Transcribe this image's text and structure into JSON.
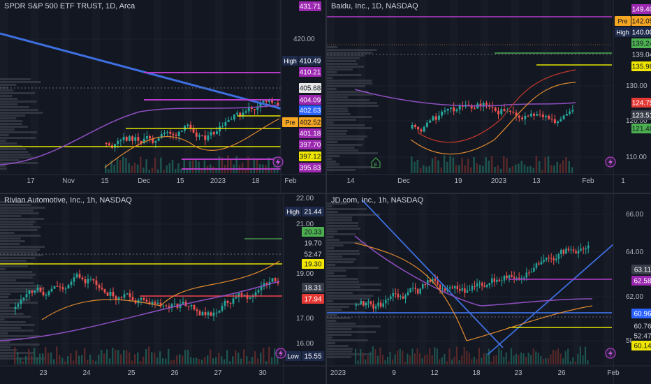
{
  "colors": {
    "background": "#131722",
    "grid": "#1e222d",
    "axis_text": "#b2b5be",
    "up": "#26a69a",
    "down": "#ef5350",
    "trendline": "#3d6fe0",
    "level_yellow": "#e6e600",
    "level_purple": "#b63cc8",
    "level_red": "#f04450",
    "level_green": "#4caf50",
    "ma_orange": "#e08a2e",
    "ma_purple": "#8e4fc0",
    "ma_red": "#c0392b"
  },
  "charts": [
    {
      "title": "SPDR S&P 500 ETF TRUST, 1D, Arca",
      "y_ticks": [
        "420.00"
      ],
      "x_ticks": [
        "17",
        "Nov",
        "15",
        "Dec",
        "15",
        "2023",
        "18",
        "Feb"
      ],
      "price_labels": [
        {
          "text": "431.71",
          "kind": "purple"
        },
        {
          "prefix": "High",
          "text": "410.49",
          "kind": "navy"
        },
        {
          "text": "410.21",
          "kind": "purple"
        },
        {
          "text": "405.68",
          "kind": "white"
        },
        {
          "text": "404.09",
          "kind": "purple"
        },
        {
          "text": "402.63",
          "kind": "blue"
        },
        {
          "prefix": "Pre",
          "text": "402.52",
          "kind": "orange"
        },
        {
          "text": "401.18",
          "kind": "purple"
        },
        {
          "text": "397.70",
          "kind": "purple"
        },
        {
          "text": "397.12",
          "kind": "yellow"
        },
        {
          "text": "395.83",
          "kind": "purple"
        }
      ],
      "icons": [
        "lightning-icon"
      ]
    },
    {
      "title": "Baidu, Inc., 1D, NASDAQ",
      "y_ticks": [
        "130.00",
        "120.00",
        "110.00"
      ],
      "x_ticks": [
        "14",
        "Dec",
        "19",
        "2023",
        "13",
        "Feb",
        "1"
      ],
      "price_labels": [
        {
          "text": "149.40",
          "kind": "purple"
        },
        {
          "prefix": "Pre",
          "text": "142.05",
          "kind": "orange"
        },
        {
          "prefix": "High",
          "text": "140.00",
          "kind": "navy"
        },
        {
          "text": "139.24",
          "kind": "green"
        },
        {
          "text": "139.04",
          "kind": "plain"
        },
        {
          "text": "135.98",
          "kind": "yellow"
        },
        {
          "text": "124.75",
          "kind": "red"
        },
        {
          "text": "123.51",
          "kind": "grey"
        },
        {
          "text": "121.48",
          "kind": "green"
        }
      ],
      "icons": [
        "earnings-icon",
        "lightning-icon"
      ]
    },
    {
      "title": "Rivian Automotive, Inc., 1h, NASDAQ",
      "y_ticks": [
        "22.00",
        "21.00",
        "19.00",
        "17.00",
        "16.00"
      ],
      "x_ticks": [
        "23",
        "24",
        "25",
        "26",
        "27",
        "30"
      ],
      "price_labels": [
        {
          "prefix": "High",
          "text": "21.44",
          "kind": "navy"
        },
        {
          "text": "20.33",
          "kind": "green"
        },
        {
          "text": "19.70",
          "kind": "plain"
        },
        {
          "text": "52:47",
          "kind": "plain"
        },
        {
          "text": "19.30",
          "kind": "yellow"
        },
        {
          "text": "18.31",
          "kind": "grey"
        },
        {
          "text": "17.94",
          "kind": "red"
        },
        {
          "prefix": "Low",
          "text": "15.55",
          "kind": "navy"
        }
      ],
      "icons": [
        "lightning-icon"
      ]
    },
    {
      "title": "JD.com, Inc., 1h, NASDAQ",
      "y_ticks": [
        "66.00",
        "64.00",
        "62.00",
        "58.00"
      ],
      "x_ticks": [
        "2023",
        "9",
        "12",
        "18",
        "23",
        "26",
        "Feb"
      ],
      "price_labels": [
        {
          "text": "63.11",
          "kind": "grey"
        },
        {
          "text": "62.58",
          "kind": "purple"
        },
        {
          "text": "60.96",
          "kind": "blue"
        },
        {
          "text": "60.76",
          "kind": "plain"
        },
        {
          "text": "52:47",
          "kind": "plain"
        },
        {
          "text": "60.14",
          "kind": "yellow"
        }
      ],
      "icons": [
        "lightning-icon"
      ]
    }
  ]
}
